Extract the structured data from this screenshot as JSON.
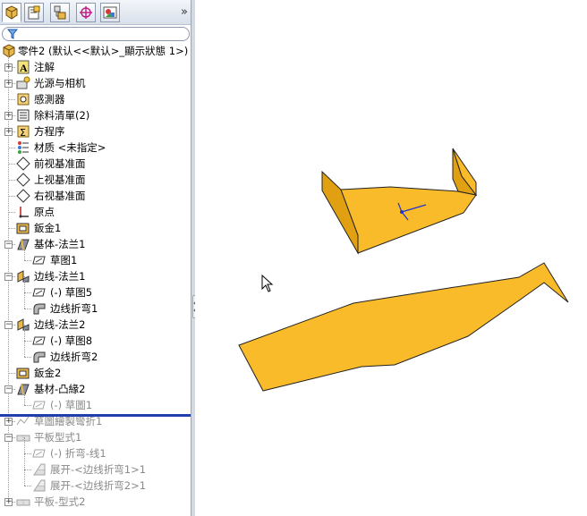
{
  "panel": {
    "tabs": [
      {
        "name": "feature-manager-tab",
        "icon": "feature-tree-icon"
      },
      {
        "name": "property-manager-tab",
        "icon": "property-icon"
      },
      {
        "name": "configuration-manager-tab",
        "icon": "configuration-icon"
      },
      {
        "name": "dimxpert-tab",
        "icon": "crosshair-icon"
      },
      {
        "name": "display-manager-tab",
        "icon": "display-icon"
      }
    ],
    "more_label": "»",
    "root_label": "零件2  (默认<<默认>_顯示狀態 1>)",
    "items": [
      {
        "label": "注解",
        "icon": "annotation-icon",
        "expander": "+",
        "gray": false
      },
      {
        "label": "光源与相机",
        "icon": "lights-camera-icon",
        "expander": "+",
        "gray": false
      },
      {
        "label": "感測器",
        "icon": "sensor-icon",
        "expander": "",
        "gray": false
      },
      {
        "label": "除料清單(2)",
        "icon": "cutlist-icon",
        "expander": "+",
        "gray": false
      },
      {
        "label": "方程序",
        "icon": "equation-icon",
        "expander": "+",
        "gray": false
      },
      {
        "label": "材质 <未指定>",
        "icon": "material-icon",
        "expander": "",
        "gray": false
      },
      {
        "label": "前视基准面",
        "icon": "plane-icon",
        "expander": "",
        "gray": false
      },
      {
        "label": "上视基准面",
        "icon": "plane-icon",
        "expander": "",
        "gray": false
      },
      {
        "label": "右视基准面",
        "icon": "plane-icon",
        "expander": "",
        "gray": false
      },
      {
        "label": "原点",
        "icon": "origin-icon",
        "expander": "",
        "gray": false
      },
      {
        "label": "鈑金1",
        "icon": "sheetmetal-icon",
        "expander": "",
        "gray": false
      },
      {
        "label": "基体-法兰1",
        "icon": "base-flange-icon",
        "expander": "-",
        "gray": false
      },
      {
        "label": "草图1",
        "icon": "sketch-icon",
        "expander": "",
        "gray": false,
        "child": true
      },
      {
        "label": "边线-法兰1",
        "icon": "edge-flange-icon",
        "expander": "-",
        "gray": false
      },
      {
        "label": "(-) 草图5",
        "icon": "sketch-icon",
        "expander": "",
        "gray": false,
        "child": true
      },
      {
        "label": "边线折弯1",
        "icon": "bend-icon",
        "expander": "",
        "gray": false,
        "child": true
      },
      {
        "label": "边线-法兰2",
        "icon": "edge-flange-icon",
        "expander": "-",
        "gray": false
      },
      {
        "label": "(-) 草图8",
        "icon": "sketch-icon",
        "expander": "",
        "gray": false,
        "child": true
      },
      {
        "label": "边线折弯2",
        "icon": "bend-icon",
        "expander": "",
        "gray": false,
        "child": true
      },
      {
        "label": "鈑金2",
        "icon": "sheetmetal-icon",
        "expander": "",
        "gray": false
      },
      {
        "label": "基材-凸緣2",
        "icon": "base-flange-icon",
        "expander": "-",
        "gray": false
      },
      {
        "label": "(-) 草圖1",
        "icon": "sketch-icon",
        "expander": "",
        "gray": true,
        "child": true
      },
      {
        "label": "草圖繪製彎折1",
        "icon": "sketched-bend-icon",
        "expander": "+",
        "gray": true
      },
      {
        "label": "平板型式1",
        "icon": "flat-pattern-icon",
        "expander": "-",
        "gray": true
      },
      {
        "label": "(-) 折弯-线1",
        "icon": "sketch-icon",
        "expander": "",
        "gray": true,
        "child": true
      },
      {
        "label": "展开-<边线折弯1>1",
        "icon": "unfold-icon",
        "expander": "",
        "gray": true,
        "child": true
      },
      {
        "label": "展开-<边线折弯2>1",
        "icon": "unfold-icon",
        "expander": "",
        "gray": true,
        "child": true
      },
      {
        "label": "平板-型式2",
        "icon": "flat-pattern-icon",
        "expander": "+",
        "gray": true
      }
    ]
  },
  "colors": {
    "part_fill": "#f9bb2a",
    "part_shade": "#e0a012",
    "rollback_bar": "#1f3fae"
  }
}
